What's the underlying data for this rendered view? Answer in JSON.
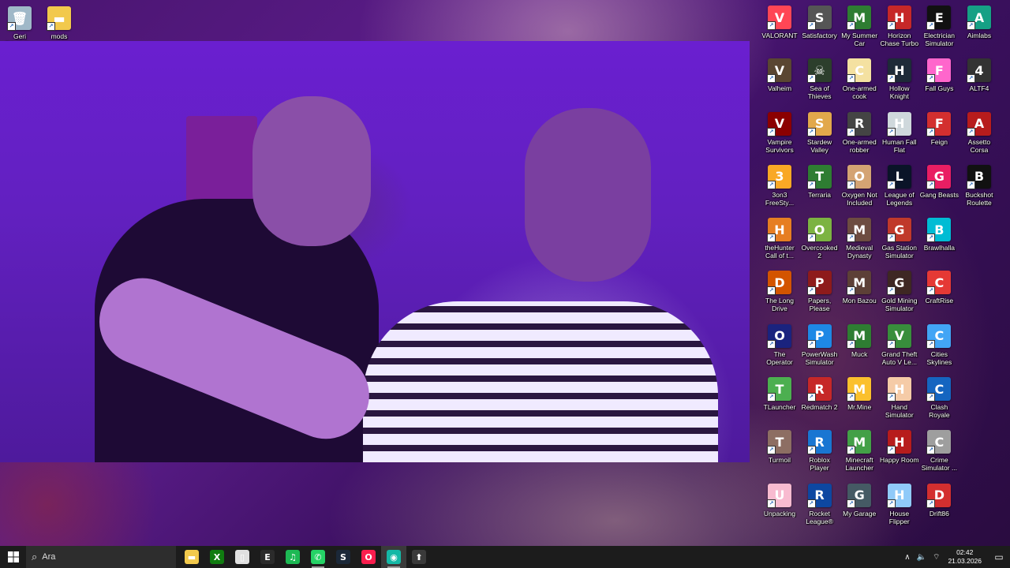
{
  "desktop": {
    "left_icons": [
      {
        "label": "Geri Dönüşüm Kutusu",
        "icon": "recycle-bin-icon",
        "color": "#9fb8c8",
        "glyph": "🗑"
      },
      {
        "label": "mods",
        "icon": "folder-icon",
        "color": "#f2c94c",
        "glyph": "▬"
      }
    ],
    "right_icons": [
      {
        "label": "VALORANT",
        "icon": "valorant-icon",
        "color": "#ff4655",
        "glyph": "V"
      },
      {
        "label": "Satisfactory",
        "icon": "satisfactory-icon",
        "color": "#555555",
        "glyph": "S"
      },
      {
        "label": "My Summer Car",
        "icon": "my-summer-car-icon",
        "color": "#2e7d32",
        "glyph": "M"
      },
      {
        "label": "Horizon Chase Turbo",
        "icon": "horizon-chase-icon",
        "color": "#c62828",
        "glyph": "H"
      },
      {
        "label": "Electrician Simulator",
        "icon": "electrician-simulator-icon",
        "color": "#111111",
        "glyph": "E"
      },
      {
        "label": "Aimlabs",
        "icon": "aimlabs-icon",
        "color": "#16a085",
        "glyph": "A"
      },
      {
        "label": "Valheim",
        "icon": "valheim-icon",
        "color": "#5a4632",
        "glyph": "V"
      },
      {
        "label": "Sea of Thieves",
        "icon": "sea-of-thieves-icon",
        "color": "#2c3e2c",
        "glyph": "☠"
      },
      {
        "label": "One-armed cook",
        "icon": "one-armed-cook-icon",
        "color": "#f4e1a1",
        "glyph": "C"
      },
      {
        "label": "Hollow Knight",
        "icon": "hollow-knight-icon",
        "color": "#1e2a38",
        "glyph": "H"
      },
      {
        "label": "Fall Guys",
        "icon": "fall-guys-icon",
        "color": "#ff66cc",
        "glyph": "F"
      },
      {
        "label": "ALTF4",
        "icon": "altf4-icon",
        "color": "#333333",
        "glyph": "4"
      },
      {
        "label": "Vampire Survivors",
        "icon": "vampire-survivors-icon",
        "color": "#8b0000",
        "glyph": "V"
      },
      {
        "label": "Stardew Valley",
        "icon": "stardew-valley-icon",
        "color": "#e2a84b",
        "glyph": "S"
      },
      {
        "label": "One-armed robber",
        "icon": "one-armed-robber-icon",
        "color": "#444444",
        "glyph": "R"
      },
      {
        "label": "Human Fall Flat",
        "icon": "human-fall-flat-icon",
        "color": "#cfd8dc",
        "glyph": "H"
      },
      {
        "label": "Feign",
        "icon": "feign-icon",
        "color": "#d32f2f",
        "glyph": "F"
      },
      {
        "label": "Assetto Corsa",
        "icon": "assetto-corsa-icon",
        "color": "#b71c1c",
        "glyph": "A"
      },
      {
        "label": "3on3 FreeSty...",
        "icon": "3on3-freestyle-icon",
        "color": "#f9a825",
        "glyph": "3"
      },
      {
        "label": "Terraria",
        "icon": "terraria-icon",
        "color": "#2e7d32",
        "glyph": "T"
      },
      {
        "label": "Oxygen Not Included",
        "icon": "oxygen-not-included-icon",
        "color": "#d4a373",
        "glyph": "O"
      },
      {
        "label": "League of Legends",
        "icon": "league-of-legends-icon",
        "color": "#0a1428",
        "glyph": "L"
      },
      {
        "label": "Gang Beasts",
        "icon": "gang-beasts-icon",
        "color": "#e91e63",
        "glyph": "G"
      },
      {
        "label": "Buckshot Roulette",
        "icon": "buckshot-roulette-icon",
        "color": "#111111",
        "glyph": "B"
      },
      {
        "label": "theHunter Call of t...",
        "icon": "thehunter-icon",
        "color": "#e67e22",
        "glyph": "H"
      },
      {
        "label": "Overcooked 2",
        "icon": "overcooked-icon",
        "color": "#7cb342",
        "glyph": "O"
      },
      {
        "label": "Medieval Dynasty",
        "icon": "medieval-dynasty-icon",
        "color": "#6d4c41",
        "glyph": "M"
      },
      {
        "label": "Gas Station Simulator",
        "icon": "gas-station-simulator-icon",
        "color": "#c0392b",
        "glyph": "G"
      },
      {
        "label": "Brawlhalla",
        "icon": "brawlhalla-icon",
        "color": "#00bcd4",
        "glyph": "B"
      },
      {
        "label": "",
        "icon": "empty-slot",
        "color": "",
        "glyph": ""
      },
      {
        "label": "The Long Drive",
        "icon": "the-long-drive-icon",
        "color": "#d35400",
        "glyph": "D"
      },
      {
        "label": "Papers, Please",
        "icon": "papers-please-icon",
        "color": "#8e1b1b",
        "glyph": "P"
      },
      {
        "label": "Mon Bazou",
        "icon": "mon-bazou-icon",
        "color": "#5d4037",
        "glyph": "M"
      },
      {
        "label": "Gold Mining Simulator",
        "icon": "gold-mining-simulator-icon",
        "color": "#3e2723",
        "glyph": "G"
      },
      {
        "label": "CraftRise",
        "icon": "craftrise-icon",
        "color": "#e53935",
        "glyph": "C"
      },
      {
        "label": "",
        "icon": "empty-slot",
        "color": "",
        "glyph": ""
      },
      {
        "label": "The Operator",
        "icon": "the-operator-icon",
        "color": "#1a237e",
        "glyph": "O"
      },
      {
        "label": "PowerWash Simulator",
        "icon": "powerwash-simulator-icon",
        "color": "#1e88e5",
        "glyph": "P"
      },
      {
        "label": "Muck",
        "icon": "muck-icon",
        "color": "#2e7d32",
        "glyph": "M"
      },
      {
        "label": "Grand Theft Auto V Le...",
        "icon": "gta-v-icon",
        "color": "#388e3c",
        "glyph": "V"
      },
      {
        "label": "Cities Skylines",
        "icon": "cities-skylines-icon",
        "color": "#42a5f5",
        "glyph": "C"
      },
      {
        "label": "",
        "icon": "empty-slot",
        "color": "",
        "glyph": ""
      },
      {
        "label": "TLauncher",
        "icon": "tlauncher-icon",
        "color": "#4caf50",
        "glyph": "T"
      },
      {
        "label": "Redmatch 2",
        "icon": "redmatch-2-icon",
        "color": "#c62828",
        "glyph": "R"
      },
      {
        "label": "Mr.Mine",
        "icon": "mr-mine-icon",
        "color": "#fbc02d",
        "glyph": "M"
      },
      {
        "label": "Hand Simulator",
        "icon": "hand-simulator-icon",
        "color": "#f5cba7",
        "glyph": "H"
      },
      {
        "label": "Clash Royale",
        "icon": "clash-royale-icon",
        "color": "#1565c0",
        "glyph": "C"
      },
      {
        "label": "",
        "icon": "empty-slot",
        "color": "",
        "glyph": ""
      },
      {
        "label": "Turmoil",
        "icon": "turmoil-icon",
        "color": "#8d6e63",
        "glyph": "T"
      },
      {
        "label": "Roblox Player",
        "icon": "roblox-player-icon",
        "color": "#1976d2",
        "glyph": "R"
      },
      {
        "label": "Minecraft Launcher",
        "icon": "minecraft-launcher-icon",
        "color": "#43a047",
        "glyph": "M"
      },
      {
        "label": "Happy Room",
        "icon": "happy-room-icon",
        "color": "#b71c1c",
        "glyph": "H"
      },
      {
        "label": "Crime Simulator ...",
        "icon": "crime-simulator-icon",
        "color": "#9e9e9e",
        "glyph": "C"
      },
      {
        "label": "",
        "icon": "empty-slot",
        "color": "",
        "glyph": ""
      },
      {
        "label": "Unpacking",
        "icon": "unpacking-icon",
        "color": "#f8bbd0",
        "glyph": "U"
      },
      {
        "label": "Rocket League®",
        "icon": "rocket-league-icon",
        "color": "#0d47a1",
        "glyph": "R"
      },
      {
        "label": "My Garage",
        "icon": "my-garage-icon",
        "color": "#455a64",
        "glyph": "G"
      },
      {
        "label": "House Flipper",
        "icon": "house-flipper-icon",
        "color": "#90caf9",
        "glyph": "H"
      },
      {
        "label": "Drift86",
        "icon": "drift86-icon",
        "color": "#d32f2f",
        "glyph": "D"
      }
    ]
  },
  "taskbar": {
    "search_placeholder": "Ara",
    "apps": [
      {
        "icon": "file-explorer-icon",
        "color": "#f2c94c",
        "glyph": "▬",
        "state": "normal"
      },
      {
        "icon": "xbox-icon",
        "color": "#107c10",
        "glyph": "X",
        "state": "normal"
      },
      {
        "icon": "notepad-icon",
        "color": "#e0e0e0",
        "glyph": "▯",
        "state": "normal"
      },
      {
        "icon": "epic-games-icon",
        "color": "#2b2b2b",
        "glyph": "E",
        "state": "normal"
      },
      {
        "icon": "spotify-icon",
        "color": "#1db954",
        "glyph": "♫",
        "state": "normal"
      },
      {
        "icon": "whatsapp-icon",
        "color": "#25d366",
        "glyph": "✆",
        "state": "running"
      },
      {
        "icon": "steam-icon",
        "color": "#1b2838",
        "glyph": "S",
        "state": "normal"
      },
      {
        "icon": "opera-gx-icon",
        "color": "#fa1e4e",
        "glyph": "O",
        "state": "normal"
      },
      {
        "icon": "camera-app-icon",
        "color": "#14b8a6",
        "glyph": "◉",
        "state": "active"
      },
      {
        "icon": "upload-app-icon",
        "color": "#3a3a3a",
        "glyph": "⬆",
        "state": "normal"
      }
    ],
    "tray": {
      "time": "02:42",
      "date": "21.03.2026"
    }
  }
}
